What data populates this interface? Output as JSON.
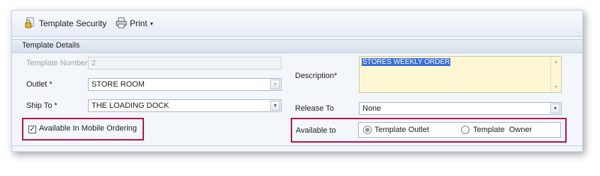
{
  "toolbar": {
    "template_security": "Template Security",
    "print": "Print",
    "template_security_icon": "padlock-document-icon",
    "print_icon": "printer-icon"
  },
  "section": {
    "title": "Template Details"
  },
  "form": {
    "template_number": {
      "label": "Template Number",
      "value": "2"
    },
    "outlet": {
      "label": "Outlet *",
      "value": "STORE ROOM"
    },
    "ship_to": {
      "label": "Ship To *",
      "value": "THE LOADING DOCK"
    },
    "description": {
      "label": "Description*",
      "value": "STORES WEEKLY ORDER"
    },
    "release_to": {
      "label": "Release To",
      "value": "None"
    },
    "mobile": {
      "label": "Available In Mobile Ordering",
      "checked": true
    },
    "available_to": {
      "label": "Available to",
      "options": [
        "Template Outlet",
        "Template  Owner"
      ],
      "selected": "Template Outlet"
    }
  },
  "colors": {
    "highlight": "#b7124e",
    "description_bg": "#fdf7d3",
    "selection": "#3a6fd6"
  }
}
